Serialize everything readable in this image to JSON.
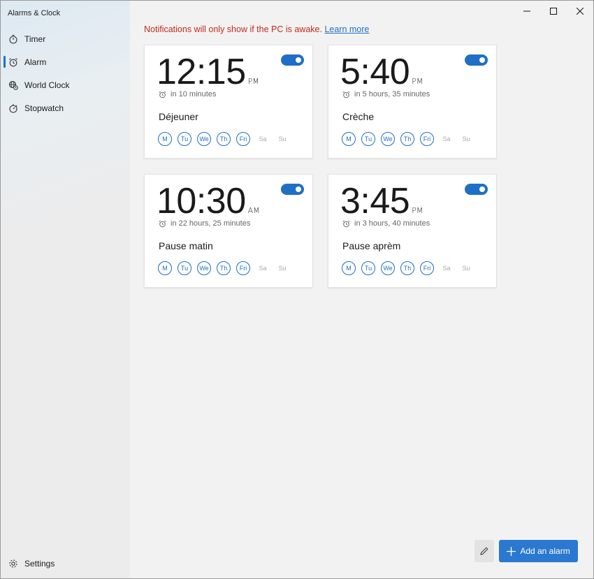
{
  "app": {
    "title": "Alarms & Clock"
  },
  "sidebar": {
    "items": [
      {
        "label": "Timer",
        "icon": "timer-icon",
        "active": false
      },
      {
        "label": "Alarm",
        "icon": "alarm-icon",
        "active": true
      },
      {
        "label": "World Clock",
        "icon": "globe-icon",
        "active": false
      },
      {
        "label": "Stopwatch",
        "icon": "stopwatch-icon",
        "active": false
      }
    ],
    "settings_label": "Settings"
  },
  "notice": {
    "text": "Notifications will only show if the PC is awake.",
    "link": "Learn more"
  },
  "alarms": [
    {
      "time": "12:15",
      "ampm": "PM",
      "remaining": "in 10 minutes",
      "name": "Déjeuner",
      "enabled": true
    },
    {
      "time": "5:40",
      "ampm": "PM",
      "remaining": "in 5 hours, 35 minutes",
      "name": "Crèche",
      "enabled": true
    },
    {
      "time": "10:30",
      "ampm": "AM",
      "remaining": "in 22 hours, 25 minutes",
      "name": "Pause matin",
      "enabled": true
    },
    {
      "time": "3:45",
      "ampm": "PM",
      "remaining": "in 3 hours, 40 minutes",
      "name": "Pause aprèm",
      "enabled": true
    }
  ],
  "days": [
    {
      "label": "M",
      "on": true
    },
    {
      "label": "Tu",
      "on": true
    },
    {
      "label": "We",
      "on": true
    },
    {
      "label": "Th",
      "on": true
    },
    {
      "label": "Fri",
      "on": true
    },
    {
      "label": "Sa",
      "on": false
    },
    {
      "label": "Su",
      "on": false
    }
  ],
  "footer": {
    "add_label": "Add an alarm"
  },
  "colors": {
    "accent": "#1f6fc6",
    "warning": "#c42b1c",
    "button": "#2b78d0"
  }
}
